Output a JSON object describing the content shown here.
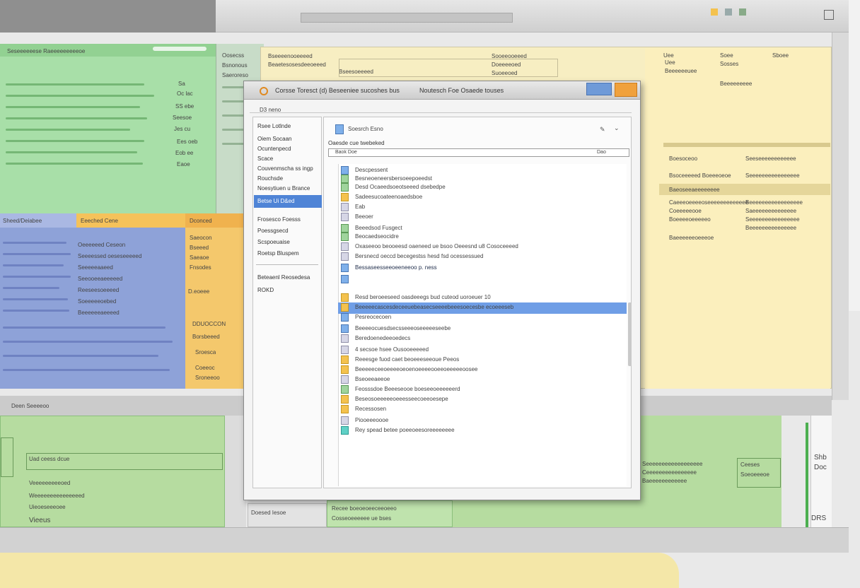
{
  "dialog": {
    "title": "Corsse Toresct (d) Beseeniee sucoshes bus",
    "title_right": "Noutesch Foe Osaede touses",
    "subtitle": "D3 neno",
    "close_label": "",
    "search_label": "Soesrch Esno",
    "heading": "Oaesde cue twebeked",
    "field_label": "Baok Doe",
    "field_value": "Dao"
  },
  "nav": {
    "items": [
      "Rsee Lotlnde",
      "Oiem Socaan",
      "Ocuntenpecd",
      "Scace",
      "Couvenmscha ss ingp",
      "Rouchsde",
      "Noesytiuen u Brance",
      "Betse Ui D&ed",
      "Frosesco Foesss",
      "Poessgsecd",
      "Scspoeuaise",
      "Roetsp Bluspem",
      "Beteaenl Reosedesa",
      "ROKD"
    ],
    "selected_index": 7
  },
  "list": {
    "rows": [
      "Descpessent",
      "Besneoeneersbersoeepoeedst",
      "Desd Ocaeedsoeotseeed dsebedpe",
      "Sadeesucoateenoaedsboe",
      "Eab",
      "Beeoer",
      "Beeedsod Fusgect",
      "Beocaedseocidre",
      "Oxaseeoo beooeesd oaeneed ue bsoo Oeeesnd u8 Cosoceeeed",
      "Bersnecd oeccd becegestss hesd fsd ocessessued",
      "Bessaseesseeoeeneeoo p. ness",
      "",
      "Resd beroeeseed oasdeeegs bud cuteod uoroeuer 10",
      "Beeeeecascesdeceeuebeasecseeeebeeesoecesbe ecoeeeseb",
      "Pesreocecoen",
      "Beeeeocuesdsecsseeeoseeeeeseebe",
      "Beredoenedeeoedecs",
      "4 secsoe hsee Ousooeeeeed",
      "Reeesge fuod caet beoeeeseeoue Peeos",
      "Beeeeeceeoeeeeoeoenoeeeeooeeoeeeeeoosee",
      "Bseoeeaeeoe",
      "Feosssdoe Beeeseooe boeseeoeeeeeerd",
      "Beseosoeeeeeoeeesseecoeeoesepe",
      "Recessosen",
      "Piooeeeoooe",
      "Rey spead betee poeeoeesoreeeeeeee"
    ]
  },
  "green_pane": {
    "header": "Seseeeeeese Raeeeeeeeeeoe",
    "values": [
      "Sa",
      "Oc lac",
      "SS ebe",
      "Seesoe",
      "Jes cu",
      "Ees oeb",
      "Eob ee",
      "Eaoe"
    ]
  },
  "mid_pane": {
    "lines": [
      "Oosecss",
      "Bsnonous",
      "Saeroreso"
    ]
  },
  "blue_pane": {
    "header": "Sheed/Deiabee",
    "header_2": "Eeeched Cene",
    "header_3": "Dconced",
    "rows": [
      "Oeeeeeed Ceseon",
      "Seeeessed oeseseeeeed",
      "Seeeeeaaeed",
      "Seeooeeaeeeeed",
      "Reeseesoeeeed",
      "Soeeeeeoebed",
      "Beeeeeeaeeeed"
    ]
  },
  "orange_pane": {
    "lines": [
      "Saeocon",
      "Bseeed",
      "Saeaoe",
      "Fnsodes",
      "D.eoeee",
      "DDUOCCON",
      "Borsbeeed",
      "Sroesca",
      "Coeeoc",
      "Sroneeoo"
    ]
  },
  "yellow_pane": {
    "top_left": [
      "Bseeeenooeeeed",
      "Beaetesosesdeeoeeed",
      "Bseesoeeeed"
    ],
    "top_mid": [
      "Sooeeooeeed",
      "Doeeeeoed",
      "Suoeeoed"
    ],
    "right_cols": [
      "Uee",
      "Soee",
      "Sboee",
      "Uee",
      "Beeeeeeuee",
      "Sosses",
      "Beeeeeeeee"
    ],
    "table_rows": [
      "Boesoceoo",
      "Bsoceeeeed Boeeeoeoe",
      "Baeoseeaeeeeeeee",
      "Caeeeoeeeeoseeeeeeeeeeeee",
      "Coeeeeeooe",
      "Boeeeeoeeeeeo",
      "Baeeeeeeoeeeoe"
    ],
    "table_rows_right": [
      "Seeseeeeeeeeeeee",
      "Seeeeeeeeeeeeeeee",
      "Beeeeeeeeeeeeeeeee",
      "Saeeeeeeeeeeeeee",
      "Seeeeeeeeeeeeeeee",
      "Beeeeeeeeeeeeeee"
    ]
  },
  "bottom": {
    "status": "Deen Seeeeoo",
    "left_lines": [
      "Uad ceess dcue",
      "Veeeeeeeeeoed",
      "Weeeeeeeeeeeeeeed",
      "Uieoeseeeoee"
    ],
    "left_footer": "Vieeus",
    "mid_tab": "Doesed Iesoe",
    "mid_tab_2": "Recee boeoeoeeceeoeeo",
    "mid_tab_3": "Cosseoeeeeee ue bses",
    "right_lines": [
      "Seeeeeeeeeeeeeeeeee",
      "Ceeeeeeeeeeeeeeee",
      "Baeeeeeeeeeeee"
    ],
    "right_box": "Ceeses",
    "right_box_2": "Soeoeeeoe",
    "right_edge": [
      "Shb",
      "Doc",
      "DRS"
    ]
  }
}
